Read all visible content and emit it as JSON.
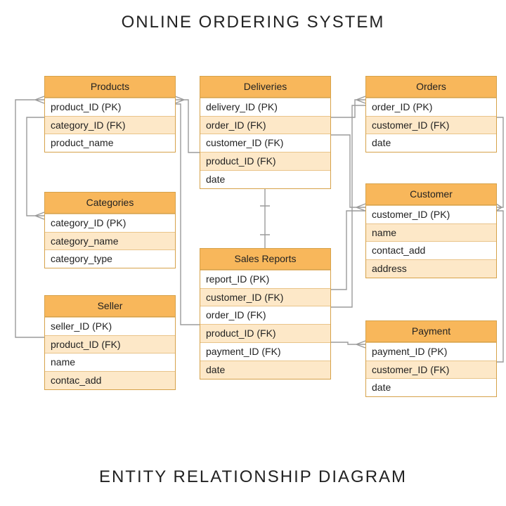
{
  "title": "ONLINE ORDERING SYSTEM",
  "footer": "ENTITY RELATIONSHIP DIAGRAM",
  "colors": {
    "entity_header": "#f8b75b",
    "entity_border": "#d6a24a",
    "zebra": "#fde8c8",
    "connector": "#9b9b9b"
  },
  "entities": {
    "products": {
      "name": "Products",
      "fields": [
        "product_ID (PK)",
        "category_ID (FK)",
        "product_name"
      ]
    },
    "categories": {
      "name": "Categories",
      "fields": [
        "category_ID (PK)",
        "category_name",
        "category_type"
      ]
    },
    "seller": {
      "name": "Seller",
      "fields": [
        "seller_ID (PK)",
        "product_ID (FK)",
        "name",
        "contac_add"
      ]
    },
    "deliveries": {
      "name": "Deliveries",
      "fields": [
        "delivery_ID (PK)",
        "order_ID (FK)",
        "customer_ID (FK)",
        "product_ID (FK)",
        "date"
      ]
    },
    "sales_reports": {
      "name": "Sales Reports",
      "fields": [
        "report_ID (PK)",
        "customer_ID (FK)",
        "order_ID (FK)",
        "product_ID (FK)",
        "payment_ID (FK)",
        "date"
      ]
    },
    "orders": {
      "name": "Orders",
      "fields": [
        "order_ID (PK)",
        "customer_ID (FK)",
        "date"
      ]
    },
    "customer": {
      "name": "Customer",
      "fields": [
        "customer_ID (PK)",
        "name",
        "contact_add",
        "address"
      ]
    },
    "payment": {
      "name": "Payment",
      "fields": [
        "payment_ID (PK)",
        "customer_ID (FK)",
        "date"
      ]
    }
  },
  "relationships": [
    {
      "from": "products.category_ID",
      "to": "categories.category_ID"
    },
    {
      "from": "seller.product_ID",
      "to": "products.product_ID"
    },
    {
      "from": "deliveries.order_ID",
      "to": "orders.order_ID"
    },
    {
      "from": "deliveries.customer_ID",
      "to": "customer.customer_ID"
    },
    {
      "from": "deliveries.product_ID",
      "to": "products.product_ID"
    },
    {
      "from": "sales_reports.customer_ID",
      "to": "customer.customer_ID"
    },
    {
      "from": "sales_reports.order_ID",
      "to": "orders.order_ID"
    },
    {
      "from": "sales_reports.product_ID",
      "to": "products.product_ID"
    },
    {
      "from": "sales_reports.payment_ID",
      "to": "payment.payment_ID"
    },
    {
      "from": "orders.customer_ID",
      "to": "customer.customer_ID"
    },
    {
      "from": "payment.customer_ID",
      "to": "customer.customer_ID"
    }
  ],
  "watermark": {
    "main": "",
    "sub": ""
  }
}
